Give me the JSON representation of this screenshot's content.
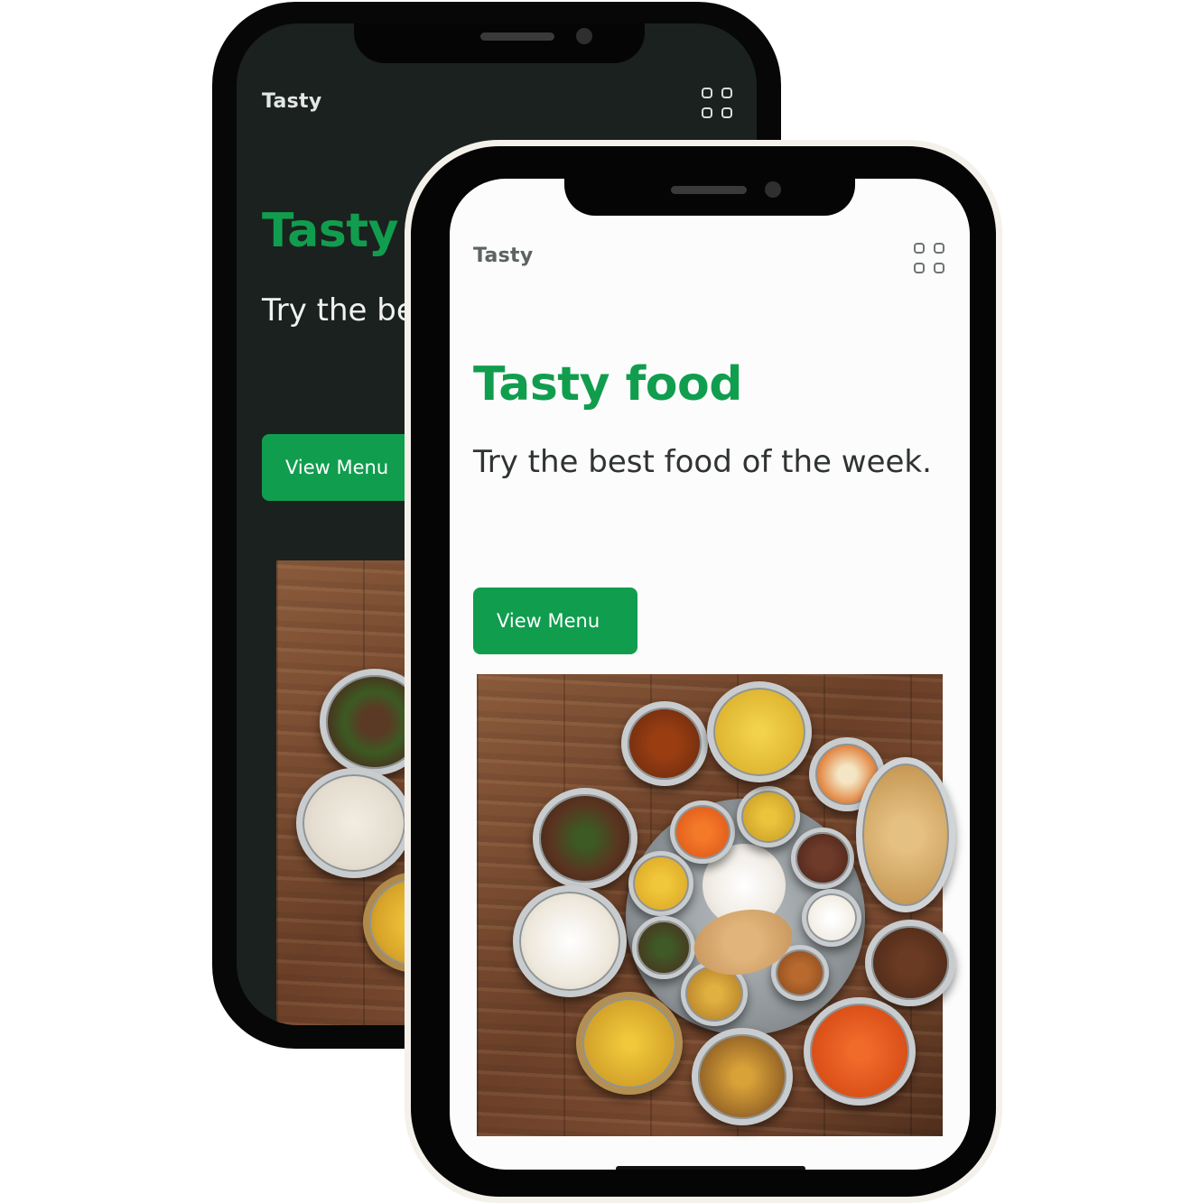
{
  "brand": "Tasty",
  "hero": {
    "title": "Tasty food",
    "subtitle": "Try the best food of the week."
  },
  "cta": {
    "label": "View Menu"
  },
  "icons": {
    "menu": "grid-icon"
  },
  "colors": {
    "accent": "#119d4e",
    "dark_background": "#1b211f",
    "light_background": "#fbfcfb"
  },
  "image": {
    "alt": "Indian thali with assorted curries, rice and breads on a wooden table"
  }
}
